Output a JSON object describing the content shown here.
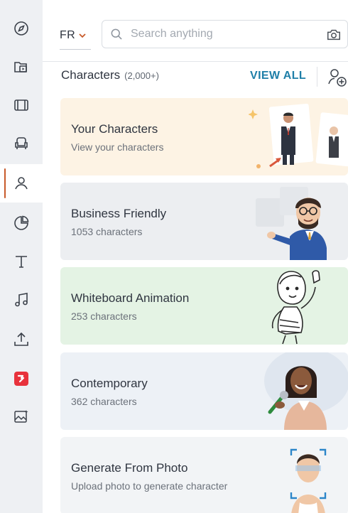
{
  "rail": {
    "items": [
      {
        "icon": "compass-icon",
        "active": false
      },
      {
        "icon": "folder-play-icon",
        "active": false
      },
      {
        "icon": "film-icon",
        "active": false
      },
      {
        "icon": "armchair-icon",
        "active": false
      },
      {
        "icon": "person-icon",
        "active": true
      },
      {
        "icon": "pie-chart-icon",
        "active": false
      },
      {
        "icon": "text-icon",
        "active": false
      },
      {
        "icon": "music-note-icon",
        "active": false
      },
      {
        "icon": "upload-icon",
        "active": false
      },
      {
        "icon": "app-logo-icon",
        "active": false
      },
      {
        "icon": "image-sparkle-icon",
        "active": false
      }
    ],
    "accent": "#c85a2a"
  },
  "topbar": {
    "language": "FR",
    "search_placeholder": "Search anything"
  },
  "section": {
    "title": "Characters",
    "count": "(2,000+)",
    "view_all": "VIEW ALL"
  },
  "cards": [
    {
      "title": "Your Characters",
      "subtitle": "View your characters",
      "bg": "#fdf3e4"
    },
    {
      "title": "Business Friendly",
      "subtitle": "1053 characters",
      "bg": "#eceef1"
    },
    {
      "title": "Whiteboard Animation",
      "subtitle": "253 characters",
      "bg": "#e4f3e4"
    },
    {
      "title": "Contemporary",
      "subtitle": "362 characters",
      "bg": "#edf1f6"
    },
    {
      "title": "Generate From Photo",
      "subtitle": "Upload photo to generate character",
      "bg": "#f2f4f6"
    }
  ],
  "colors": {
    "link": "#1f7fa8",
    "text": "#2f3540",
    "muted": "#6b717a"
  }
}
